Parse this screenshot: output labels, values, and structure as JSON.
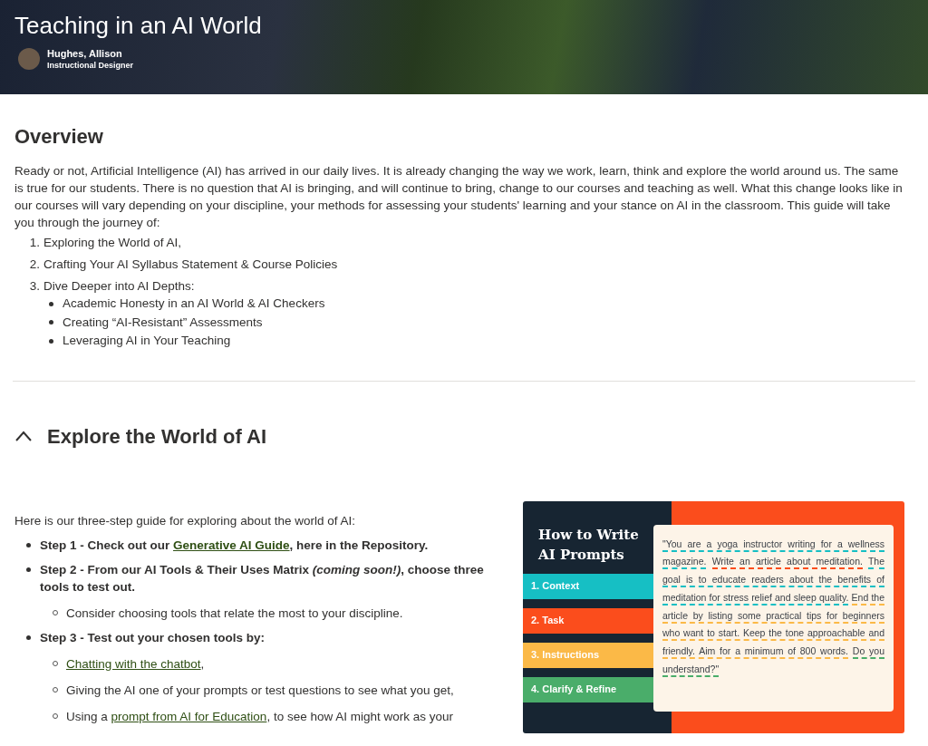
{
  "header": {
    "title": "Teaching in an AI World",
    "author": {
      "name": "Hughes, Allison",
      "role": "Instructional Designer"
    }
  },
  "overview": {
    "heading": "Overview",
    "paragraph": "Ready or not, Artificial Intelligence (AI) has arrived in our daily lives. It is already changing the way we work, learn, think and explore the world around us. The same is true for our students. There is no question that AI is bringing, and will continue to bring, change to our courses and teaching as well. What this change looks like in our courses will vary depending on your discipline, your methods for assessing your students' learning and your stance on AI in the classroom. This guide will take you through the journey of:",
    "items": [
      {
        "marker": "1.",
        "text": "Exploring the World of AI,"
      },
      {
        "marker": "2.",
        "text": "Crafting Your AI Syllabus Statement & Course Policies"
      },
      {
        "marker": "3.",
        "text": "Dive Deeper into AI Depths:",
        "children": [
          "Academic Honesty in an AI World & AI Checkers",
          "Creating “AI-Resistant” Assessments",
          "Leveraging AI in Your Teaching"
        ]
      }
    ]
  },
  "explore": {
    "heading": "Explore the World of AI",
    "expanded": true,
    "intro": "Here is our three-step guide for exploring about the world of AI:",
    "steps": [
      {
        "segments": [
          {
            "kind": "text",
            "text": "Step 1 - Check out our "
          },
          {
            "kind": "link",
            "text": "Generative AI Guide"
          },
          {
            "kind": "text",
            "text": ", here in the Repository."
          }
        ]
      },
      {
        "segments": [
          {
            "kind": "text",
            "text": "Step 2 - From our AI Tools & Their Uses Matrix *(coming soon!)*, choose three tools to test out."
          }
        ],
        "children": [
          [
            {
              "kind": "text",
              "text": "Consider choosing tools that relate the most to your discipline."
            }
          ]
        ]
      },
      {
        "segments": [
          {
            "kind": "text",
            "text": "Step 3 - Test out your chosen tools by:"
          }
        ],
        "children": [
          [
            {
              "kind": "link",
              "text": "Chatting with the chatbot"
            },
            {
              "kind": "text",
              "text": ","
            }
          ],
          [
            {
              "kind": "text",
              "text": "Giving the AI one of your prompts or test questions to see what you get,"
            }
          ],
          [
            {
              "kind": "text",
              "text": "Using a "
            },
            {
              "kind": "link",
              "text": "prompt from AI for Education"
            },
            {
              "kind": "text",
              "text": ", to see how AI might work as your"
            }
          ]
        ]
      }
    ],
    "graphic": {
      "title": "How to Write AI Prompts",
      "labels": [
        {
          "text": "1. Context",
          "color": "#16bfc4"
        },
        {
          "text": "2. Task",
          "color": "#fb4d1c"
        },
        {
          "text": "3. Instructions",
          "color": "#fbb947"
        },
        {
          "text": "4. Clarify & Refine",
          "color": "#4aad6a"
        }
      ],
      "quote": [
        {
          "text": "\"You are a yoga instructor writing for a wellness magazine.",
          "color": "#16bfc4"
        },
        {
          "text": "Write an article about meditation.",
          "color": "#fb4d1c"
        },
        {
          "text": "The goal is to educate readers about the benefits of meditation for stress relief and sleep quality.",
          "color": "#16bfc4"
        },
        {
          "text": "End the article by listing some practical tips for beginners who want to start. Keep the tone approachable and friendly. Aim for a minimum of 800 words.",
          "color": "#fbb947"
        },
        {
          "text": "Do you understand?\"",
          "color": "#4aad6a"
        }
      ]
    }
  }
}
